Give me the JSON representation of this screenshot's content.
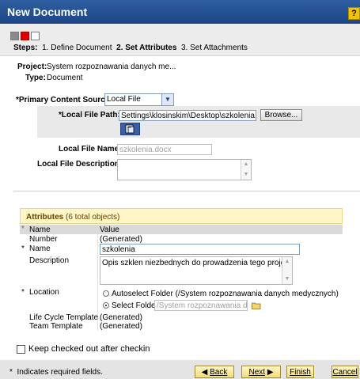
{
  "window": {
    "title": "New Document",
    "help_label": "?"
  },
  "steps": {
    "label": "Steps:",
    "items": [
      {
        "num": "1.",
        "label": "Define Document"
      },
      {
        "num": "2.",
        "label": "Set Attributes"
      },
      {
        "num": "3.",
        "label": "Set Attachments"
      }
    ]
  },
  "summary": {
    "project_label": "Project:",
    "project_value": "System rozpoznawania danych me...",
    "type_label": "Type:",
    "type_value": "Document"
  },
  "form": {
    "primary_source_label": "*Primary Content Source:",
    "primary_source_value": "Local File",
    "local_file_path_label": "*Local File Path:",
    "local_file_path_value": "Settings\\klosinskim\\Desktop\\szkolenia.docx",
    "browse_label": "Browse...",
    "local_file_name_label": "Local File Name:",
    "local_file_name_value": "szkolenia.docx",
    "local_file_desc_label": "Local File Description:",
    "local_file_desc_value": ""
  },
  "attributes": {
    "title": "Attributes",
    "count_text": "(6 total objects)",
    "col_name": "Name",
    "col_value": "Value",
    "rows": {
      "number": {
        "name": "Number",
        "value": "(Generated)"
      },
      "name": {
        "name": "Name",
        "value": "szkolenia"
      },
      "description": {
        "name": "Description",
        "value": "Opis szklen niezbednych do prowadzenia tego projektu"
      },
      "location": {
        "name": "Location",
        "autoselect_label": "Autoselect Folder (/System rozpoznawania danych medycznych)",
        "select_label": "Select Folder",
        "select_value": "/System rozpoznawania danych"
      },
      "lifecycle": {
        "name": "Life Cycle Template",
        "value": "(Generated)"
      },
      "team": {
        "name": "Team Template",
        "value": "(Generated)"
      }
    }
  },
  "keep_checked_out_label": "Keep checked out after checkin",
  "footer": {
    "required_note": "Indicates required fields.",
    "back_label": "Back",
    "next_label": "Next",
    "finish_label": "Finish",
    "cancel_label": "Cancel"
  },
  "colors": {
    "title_bar": "#1f4a8e",
    "attributes_header": "#fff6c7",
    "footer_buttons": "#f2dc7a"
  },
  "required_marker": "*"
}
